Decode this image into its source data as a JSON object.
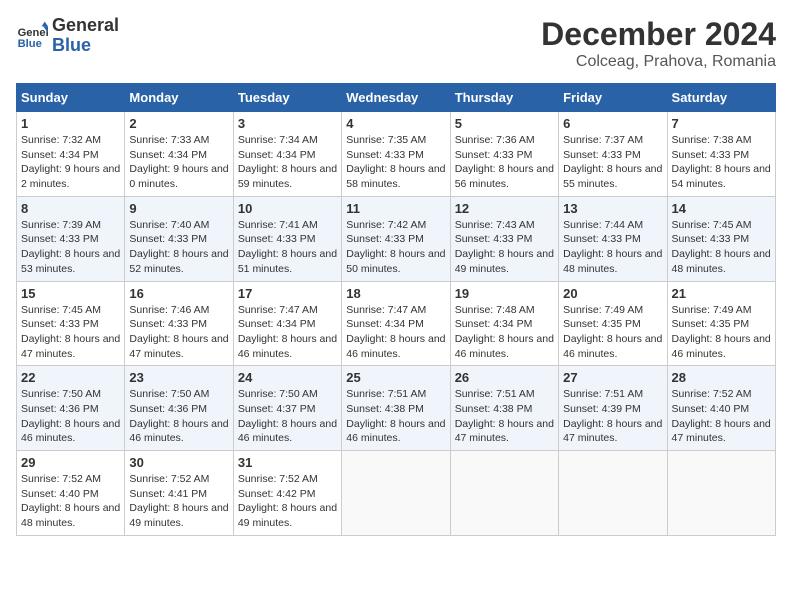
{
  "header": {
    "logo_line1": "General",
    "logo_line2": "Blue",
    "month_year": "December 2024",
    "location": "Colceag, Prahova, Romania"
  },
  "days_of_week": [
    "Sunday",
    "Monday",
    "Tuesday",
    "Wednesday",
    "Thursday",
    "Friday",
    "Saturday"
  ],
  "weeks": [
    [
      {
        "day": "1",
        "sunrise": "7:32 AM",
        "sunset": "4:34 PM",
        "daylight": "9 hours and 2 minutes."
      },
      {
        "day": "2",
        "sunrise": "7:33 AM",
        "sunset": "4:34 PM",
        "daylight": "9 hours and 0 minutes."
      },
      {
        "day": "3",
        "sunrise": "7:34 AM",
        "sunset": "4:34 PM",
        "daylight": "8 hours and 59 minutes."
      },
      {
        "day": "4",
        "sunrise": "7:35 AM",
        "sunset": "4:33 PM",
        "daylight": "8 hours and 58 minutes."
      },
      {
        "day": "5",
        "sunrise": "7:36 AM",
        "sunset": "4:33 PM",
        "daylight": "8 hours and 56 minutes."
      },
      {
        "day": "6",
        "sunrise": "7:37 AM",
        "sunset": "4:33 PM",
        "daylight": "8 hours and 55 minutes."
      },
      {
        "day": "7",
        "sunrise": "7:38 AM",
        "sunset": "4:33 PM",
        "daylight": "8 hours and 54 minutes."
      }
    ],
    [
      {
        "day": "8",
        "sunrise": "7:39 AM",
        "sunset": "4:33 PM",
        "daylight": "8 hours and 53 minutes."
      },
      {
        "day": "9",
        "sunrise": "7:40 AM",
        "sunset": "4:33 PM",
        "daylight": "8 hours and 52 minutes."
      },
      {
        "day": "10",
        "sunrise": "7:41 AM",
        "sunset": "4:33 PM",
        "daylight": "8 hours and 51 minutes."
      },
      {
        "day": "11",
        "sunrise": "7:42 AM",
        "sunset": "4:33 PM",
        "daylight": "8 hours and 50 minutes."
      },
      {
        "day": "12",
        "sunrise": "7:43 AM",
        "sunset": "4:33 PM",
        "daylight": "8 hours and 49 minutes."
      },
      {
        "day": "13",
        "sunrise": "7:44 AM",
        "sunset": "4:33 PM",
        "daylight": "8 hours and 48 minutes."
      },
      {
        "day": "14",
        "sunrise": "7:45 AM",
        "sunset": "4:33 PM",
        "daylight": "8 hours and 48 minutes."
      }
    ],
    [
      {
        "day": "15",
        "sunrise": "7:45 AM",
        "sunset": "4:33 PM",
        "daylight": "8 hours and 47 minutes."
      },
      {
        "day": "16",
        "sunrise": "7:46 AM",
        "sunset": "4:33 PM",
        "daylight": "8 hours and 47 minutes."
      },
      {
        "day": "17",
        "sunrise": "7:47 AM",
        "sunset": "4:34 PM",
        "daylight": "8 hours and 46 minutes."
      },
      {
        "day": "18",
        "sunrise": "7:47 AM",
        "sunset": "4:34 PM",
        "daylight": "8 hours and 46 minutes."
      },
      {
        "day": "19",
        "sunrise": "7:48 AM",
        "sunset": "4:34 PM",
        "daylight": "8 hours and 46 minutes."
      },
      {
        "day": "20",
        "sunrise": "7:49 AM",
        "sunset": "4:35 PM",
        "daylight": "8 hours and 46 minutes."
      },
      {
        "day": "21",
        "sunrise": "7:49 AM",
        "sunset": "4:35 PM",
        "daylight": "8 hours and 46 minutes."
      }
    ],
    [
      {
        "day": "22",
        "sunrise": "7:50 AM",
        "sunset": "4:36 PM",
        "daylight": "8 hours and 46 minutes."
      },
      {
        "day": "23",
        "sunrise": "7:50 AM",
        "sunset": "4:36 PM",
        "daylight": "8 hours and 46 minutes."
      },
      {
        "day": "24",
        "sunrise": "7:50 AM",
        "sunset": "4:37 PM",
        "daylight": "8 hours and 46 minutes."
      },
      {
        "day": "25",
        "sunrise": "7:51 AM",
        "sunset": "4:38 PM",
        "daylight": "8 hours and 46 minutes."
      },
      {
        "day": "26",
        "sunrise": "7:51 AM",
        "sunset": "4:38 PM",
        "daylight": "8 hours and 47 minutes."
      },
      {
        "day": "27",
        "sunrise": "7:51 AM",
        "sunset": "4:39 PM",
        "daylight": "8 hours and 47 minutes."
      },
      {
        "day": "28",
        "sunrise": "7:52 AM",
        "sunset": "4:40 PM",
        "daylight": "8 hours and 47 minutes."
      }
    ],
    [
      {
        "day": "29",
        "sunrise": "7:52 AM",
        "sunset": "4:40 PM",
        "daylight": "8 hours and 48 minutes."
      },
      {
        "day": "30",
        "sunrise": "7:52 AM",
        "sunset": "4:41 PM",
        "daylight": "8 hours and 49 minutes."
      },
      {
        "day": "31",
        "sunrise": "7:52 AM",
        "sunset": "4:42 PM",
        "daylight": "8 hours and 49 minutes."
      },
      null,
      null,
      null,
      null
    ]
  ]
}
